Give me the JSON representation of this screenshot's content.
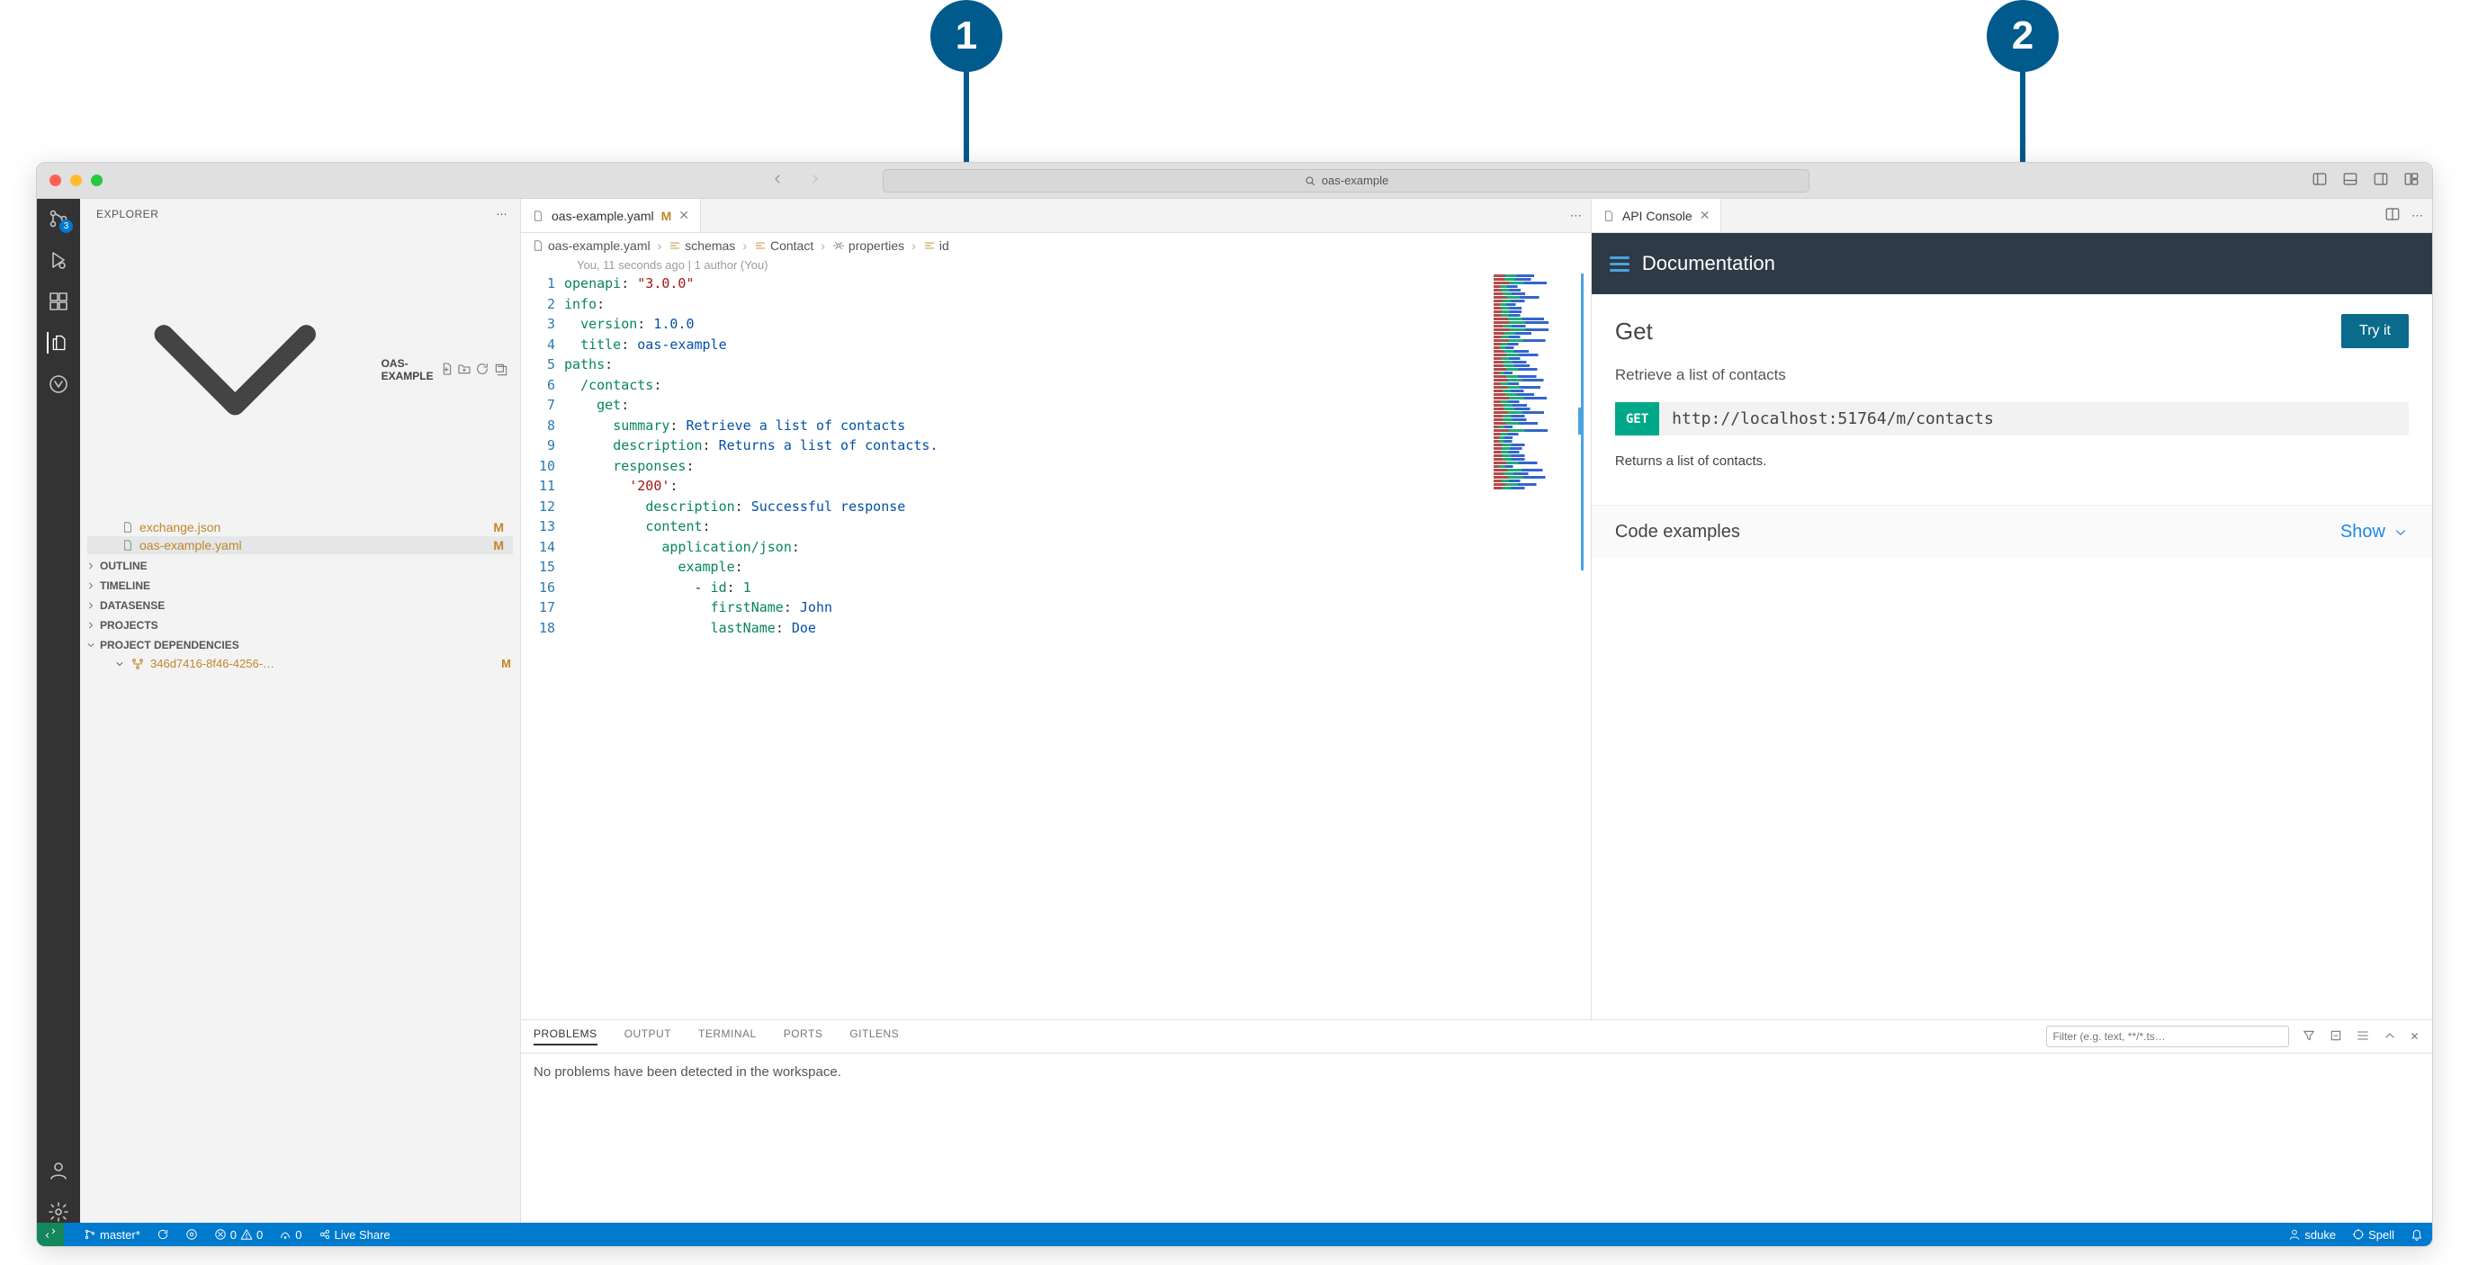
{
  "callouts": [
    "1",
    "2"
  ],
  "titlebar": {
    "search_text": "oas-example"
  },
  "activitybar": {
    "scm_badge": "3"
  },
  "sidebar": {
    "title": "EXPLORER",
    "project": "OAS-EXAMPLE",
    "files": [
      {
        "name": "exchange.json",
        "m": "M",
        "modified": true
      },
      {
        "name": "oas-example.yaml",
        "m": "M",
        "modified": true,
        "selected": true
      }
    ],
    "sections": [
      "OUTLINE",
      "TIMELINE",
      "DATASENSE",
      "PROJECTS"
    ],
    "deps_label": "PROJECT DEPENDENCIES",
    "dep": {
      "name": "346d7416-8f46-4256-…",
      "m": "M"
    }
  },
  "editor": {
    "tab_label": "oas-example.yaml",
    "tab_m": "M",
    "breadcrumb": {
      "file": "oas-example.yaml",
      "segments": [
        "schemas",
        "Contact",
        "properties",
        "id"
      ]
    },
    "blame": "You, 11 seconds ago | 1 author (You)",
    "lines": [
      [
        {
          "c": "key",
          "t": "openapi"
        },
        {
          "c": "",
          "t": ": "
        },
        {
          "c": "str",
          "t": "\"3.0.0\""
        }
      ],
      [
        {
          "c": "key",
          "t": "info"
        },
        {
          "c": "",
          "t": ":"
        }
      ],
      [
        {
          "c": "",
          "t": "  "
        },
        {
          "c": "key",
          "t": "version"
        },
        {
          "c": "",
          "t": ": "
        },
        {
          "c": "lit",
          "t": "1.0.0"
        }
      ],
      [
        {
          "c": "",
          "t": "  "
        },
        {
          "c": "key",
          "t": "title"
        },
        {
          "c": "",
          "t": ": "
        },
        {
          "c": "lit",
          "t": "oas-example"
        }
      ],
      [
        {
          "c": "key",
          "t": "paths"
        },
        {
          "c": "",
          "t": ":"
        }
      ],
      [
        {
          "c": "",
          "t": "  "
        },
        {
          "c": "key",
          "t": "/contacts"
        },
        {
          "c": "",
          "t": ":"
        }
      ],
      [
        {
          "c": "",
          "t": "    "
        },
        {
          "c": "key",
          "t": "get"
        },
        {
          "c": "",
          "t": ":"
        }
      ],
      [
        {
          "c": "",
          "t": "      "
        },
        {
          "c": "key",
          "t": "summary"
        },
        {
          "c": "",
          "t": ": "
        },
        {
          "c": "lit",
          "t": "Retrieve a list of contacts"
        }
      ],
      [
        {
          "c": "",
          "t": "      "
        },
        {
          "c": "key",
          "t": "description"
        },
        {
          "c": "",
          "t": ": "
        },
        {
          "c": "lit",
          "t": "Returns a list of contacts."
        }
      ],
      [
        {
          "c": "",
          "t": "      "
        },
        {
          "c": "key",
          "t": "responses"
        },
        {
          "c": "",
          "t": ":"
        }
      ],
      [
        {
          "c": "",
          "t": "        "
        },
        {
          "c": "str",
          "t": "'200'"
        },
        {
          "c": "",
          "t": ":"
        }
      ],
      [
        {
          "c": "",
          "t": "          "
        },
        {
          "c": "key",
          "t": "description"
        },
        {
          "c": "",
          "t": ": "
        },
        {
          "c": "lit",
          "t": "Successful response"
        }
      ],
      [
        {
          "c": "",
          "t": "          "
        },
        {
          "c": "key",
          "t": "content"
        },
        {
          "c": "",
          "t": ":"
        }
      ],
      [
        {
          "c": "",
          "t": "            "
        },
        {
          "c": "key",
          "t": "application/json"
        },
        {
          "c": "",
          "t": ":"
        }
      ],
      [
        {
          "c": "",
          "t": "              "
        },
        {
          "c": "key",
          "t": "example"
        },
        {
          "c": "",
          "t": ":"
        }
      ],
      [
        {
          "c": "",
          "t": "                - "
        },
        {
          "c": "key",
          "t": "id"
        },
        {
          "c": "",
          "t": ": "
        },
        {
          "c": "num",
          "t": "1"
        }
      ],
      [
        {
          "c": "",
          "t": "                  "
        },
        {
          "c": "key",
          "t": "firstName"
        },
        {
          "c": "",
          "t": ": "
        },
        {
          "c": "lit",
          "t": "John"
        }
      ],
      [
        {
          "c": "",
          "t": "                  "
        },
        {
          "c": "key",
          "t": "lastName"
        },
        {
          "c": "",
          "t": ": "
        },
        {
          "c": "lit",
          "t": "Doe"
        }
      ]
    ]
  },
  "console": {
    "tab_label": "API Console",
    "doc_title": "Documentation",
    "op_title": "Get",
    "try_label": "Try it",
    "summary": "Retrieve a list of contacts",
    "method": "GET",
    "url": "http://localhost:51764/m/contacts",
    "description": "Returns a list of contacts.",
    "codeex_label": "Code examples",
    "show_label": "Show"
  },
  "panel": {
    "tabs": [
      "PROBLEMS",
      "OUTPUT",
      "TERMINAL",
      "PORTS",
      "GITLENS"
    ],
    "filter_placeholder": "Filter (e.g. text, **/*.ts…",
    "empty": "No problems have been detected in the workspace."
  },
  "statusbar": {
    "branch": "master*",
    "errors": "0",
    "warnings": "0",
    "ports": "0",
    "liveshare": "Live Share",
    "user": "sduke",
    "spell": "Spell"
  }
}
